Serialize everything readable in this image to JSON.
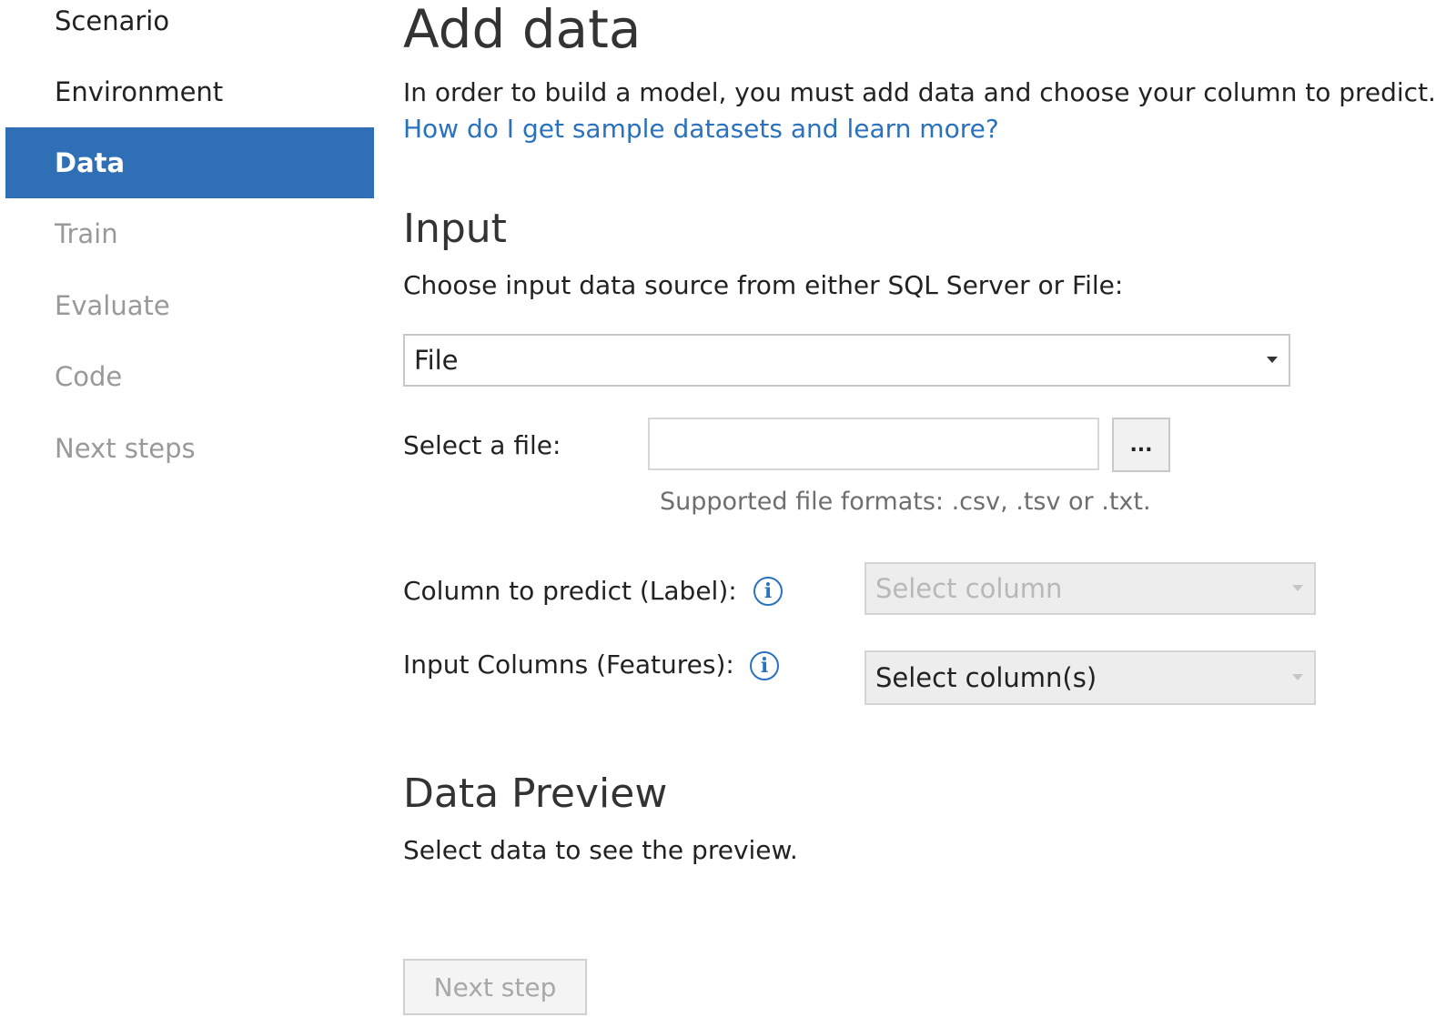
{
  "sidebar": {
    "items": [
      {
        "label": "Scenario",
        "state": "done"
      },
      {
        "label": "Environment",
        "state": "done"
      },
      {
        "label": "Data",
        "state": "active"
      },
      {
        "label": "Train",
        "state": "pending"
      },
      {
        "label": "Evaluate",
        "state": "pending"
      },
      {
        "label": "Code",
        "state": "pending"
      },
      {
        "label": "Next steps",
        "state": "pending"
      }
    ]
  },
  "header": {
    "title": "Add data",
    "description": "In order to build a model, you must add data and choose your column to predict.",
    "help_link": "How do I get sample datasets and learn more?"
  },
  "input_section": {
    "title": "Input",
    "instruction": "Choose input data source from either SQL Server or File:",
    "source_value": "File",
    "file_label": "Select a file:",
    "file_value": "",
    "browse_label": "...",
    "formats_hint": "Supported file formats: .csv, .tsv or .txt.",
    "label_column_label": "Column to predict (Label):",
    "label_column_placeholder": "Select column",
    "features_label": "Input Columns (Features):",
    "features_placeholder": "Select column(s)"
  },
  "preview_section": {
    "title": "Data Preview",
    "message": "Select data to see the preview."
  },
  "footer": {
    "next_button": "Next step"
  },
  "colors": {
    "accent": "#2f6fb5",
    "link": "#2a72bd",
    "disabled_text": "#999999"
  }
}
